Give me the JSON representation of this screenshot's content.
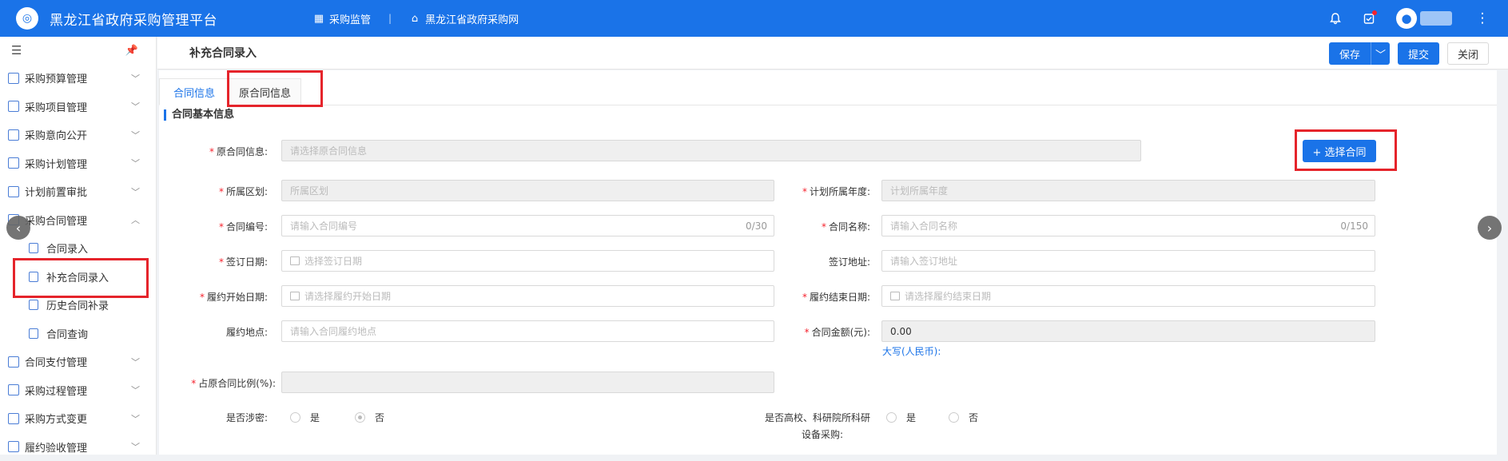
{
  "header": {
    "logo_text": "◎",
    "app_title": "黑龙江省政府采购管理平台",
    "nav_purchase_monitor": "采购监管",
    "nav_separator": "|",
    "nav_procurement_site": "黑龙江省政府采购网"
  },
  "sidebar": {
    "items": [
      {
        "label": "采购预算管理"
      },
      {
        "label": "采购项目管理"
      },
      {
        "label": "采购意向公开"
      },
      {
        "label": "采购计划管理"
      },
      {
        "label": "计划前置审批"
      },
      {
        "label": "采购合同管理"
      }
    ],
    "sub_items": [
      {
        "label": "合同录入"
      },
      {
        "label": "补充合同录入"
      },
      {
        "label": "历史合同补录"
      },
      {
        "label": "合同查询"
      }
    ],
    "items_after": [
      {
        "label": "合同支付管理"
      },
      {
        "label": "采购过程管理"
      },
      {
        "label": "采购方式变更"
      },
      {
        "label": "履约验收管理"
      }
    ]
  },
  "page": {
    "title": "补充合同录入",
    "save_label": "保存",
    "submit_label": "提交",
    "close_label": "关闭"
  },
  "tabs": {
    "contract_info": "合同信息",
    "original_contract_info": "原合同信息"
  },
  "section": {
    "title": "合同基本信息"
  },
  "form": {
    "original_contract": {
      "label": "原合同信息:",
      "placeholder": "请选择原合同信息"
    },
    "select_contract_button": "+ 选择合同",
    "region": {
      "label": "所属区划:",
      "placeholder": "所属区划"
    },
    "plan_year": {
      "label": "计划所属年度:",
      "placeholder": "计划所属年度"
    },
    "contract_no": {
      "label": "合同编号:",
      "placeholder": "请输入合同编号",
      "count": "0/30"
    },
    "contract_name": {
      "label": "合同名称:",
      "placeholder": "请输入合同名称",
      "count": "0/150"
    },
    "sign_date": {
      "label": "签订日期:",
      "placeholder": "选择签订日期"
    },
    "sign_address": {
      "label": "签订地址:",
      "placeholder": "请输入签订地址"
    },
    "perf_start": {
      "label": "履约开始日期:",
      "placeholder": "请选择履约开始日期"
    },
    "perf_end": {
      "label": "履约结束日期:",
      "placeholder": "请选择履约结束日期"
    },
    "perf_place": {
      "label": "履约地点:",
      "placeholder": "请输入合同履约地点"
    },
    "amount": {
      "label": "合同金额(元):",
      "value": "0.00"
    },
    "amount_upper": "大写(人民币):",
    "ratio": {
      "label": "占原合同比例(%):"
    },
    "is_secret": {
      "label": "是否涉密:",
      "yes": "是",
      "no": "否"
    },
    "is_university": {
      "label_line1": "是否高校、科研院所科研",
      "label_line2": "设备采购:",
      "yes": "是",
      "no": "否"
    }
  }
}
